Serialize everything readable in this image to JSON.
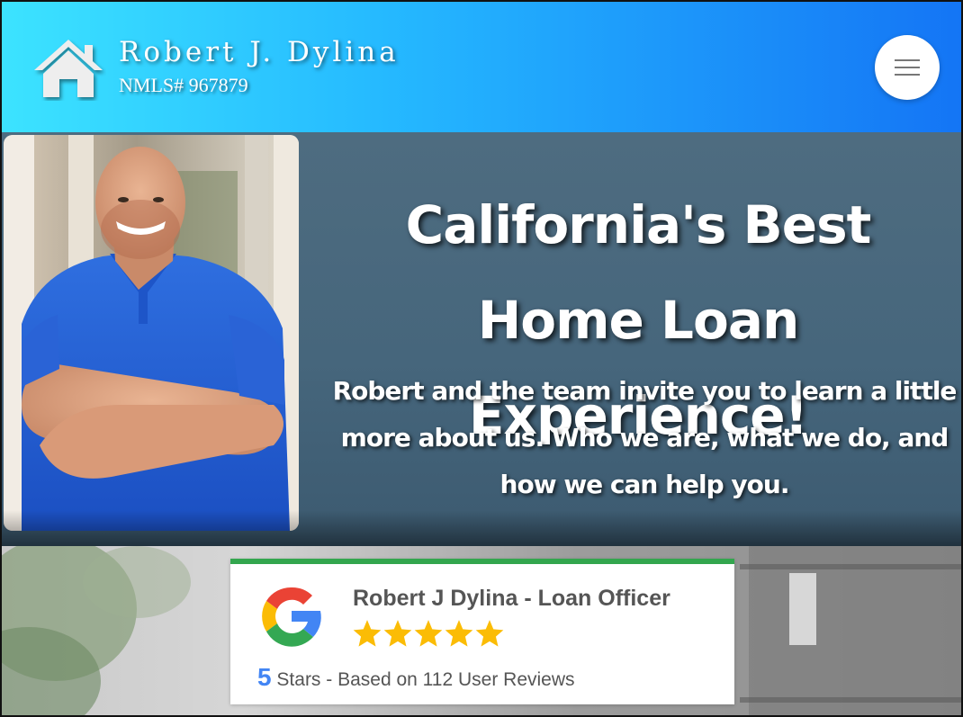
{
  "header": {
    "name": "Robert J. Dylina",
    "nmls": "NMLS# 967879",
    "logo_icon": "house-icon",
    "menu_icon": "hamburger-menu-icon",
    "colors": {
      "gradient_start": "#3ce3ff",
      "gradient_end": "#1475f5"
    }
  },
  "hero": {
    "title": "California's Best Home Loan Experience!",
    "subtitle": "Robert and the team invite you to learn a little more about us. Who we are, what we do, and how we can help you.",
    "background": "#4a687c",
    "photo": "portrait of smiling man in blue polo shirt with arms crossed"
  },
  "review": {
    "logo_icon": "google-g-icon",
    "name": "Robert J Dylina - Loan Officer",
    "star_count": 5,
    "rating": "5",
    "rating_text": "Stars - Based on 112 User Reviews",
    "colors": {
      "accent": "#33a64e",
      "star": "#fbbc05",
      "rating": "#4285f4"
    }
  }
}
